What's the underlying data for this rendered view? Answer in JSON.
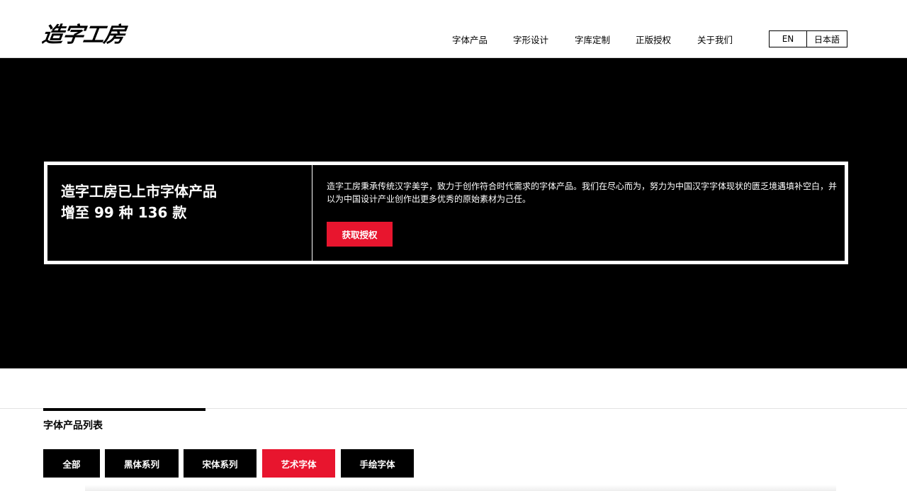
{
  "header": {
    "logo": "造字工房",
    "nav": [
      "字体产品",
      "字形设计",
      "字库定制",
      "正版授权",
      "关于我们"
    ],
    "lang": [
      "EN",
      "日本語"
    ]
  },
  "hero": {
    "title_line1": "造字工房已上市字体产品",
    "title_line2": "增至 99 种 136 款",
    "description": "造字工房秉承传统汉字美学，致力于创作符合时代需求的字体产品。我们在尽心而为，努力为中国汉字字体现状的匮乏境遇填补空白，并以为中国设计产业创作出更多优秀的原始素材为己任。",
    "button": "获取授权"
  },
  "section": {
    "title": "字体产品列表"
  },
  "filters": {
    "items": [
      "全部",
      "黑体系列",
      "宋体系列",
      "艺术字体",
      "手绘字体"
    ],
    "active": "艺术字体"
  },
  "colors": {
    "accent": "#e8152e",
    "hero_bg": "#000000"
  }
}
